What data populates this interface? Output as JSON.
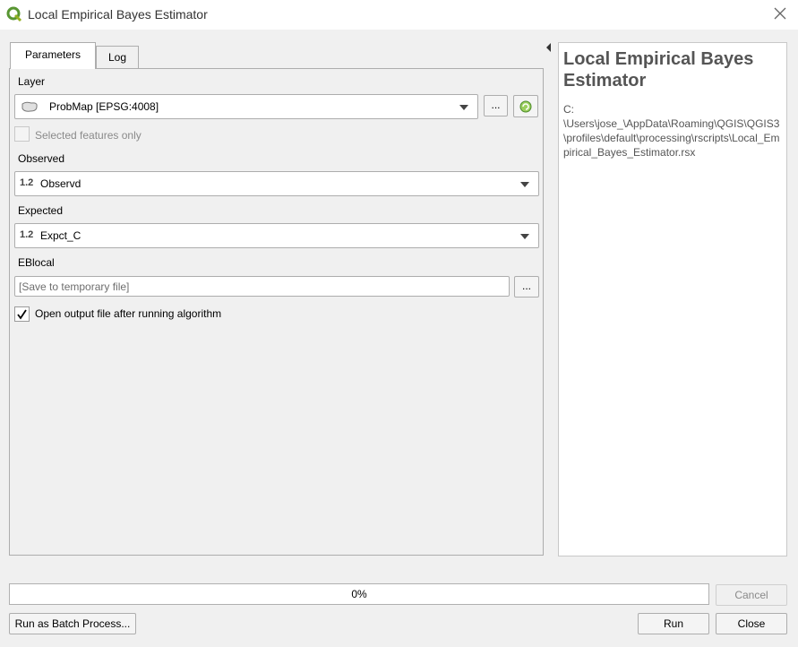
{
  "window": {
    "title": "Local Empirical Bayes Estimator",
    "app_icon": "qgis-icon",
    "close_icon": "close-icon"
  },
  "tabs": [
    {
      "label": "Parameters"
    },
    {
      "label": "Log"
    }
  ],
  "params": {
    "layer": {
      "label": "Layer",
      "value": "ProbMap  [EPSG:4008]",
      "browse_label": "..."
    },
    "selected_only": {
      "label": "Selected features only",
      "checked": false
    },
    "observed": {
      "label": "Observed",
      "type_badge": "1.2",
      "value": "Observd"
    },
    "expected": {
      "label": "Expected",
      "type_badge": "1.2",
      "value": "Expct_C"
    },
    "eblocal": {
      "label": "EBlocal",
      "placeholder": "[Save to temporary file]",
      "browse_label": "..."
    },
    "open_output": {
      "label": "Open output file after running algorithm",
      "checked": true
    }
  },
  "help": {
    "title": "Local Empirical Bayes Estimator",
    "path": "C:\n\\Users\\jose_\\AppData\\Roaming\\QGIS\\QGIS3\\profiles\\default\\processing\\rscripts\\Local_Empirical_Bayes_Estimator.rsx"
  },
  "progress": {
    "text": "0%",
    "fraction": 0
  },
  "buttons": {
    "cancel": "Cancel",
    "batch": "Run as Batch Process...",
    "run": "Run",
    "close": "Close"
  }
}
